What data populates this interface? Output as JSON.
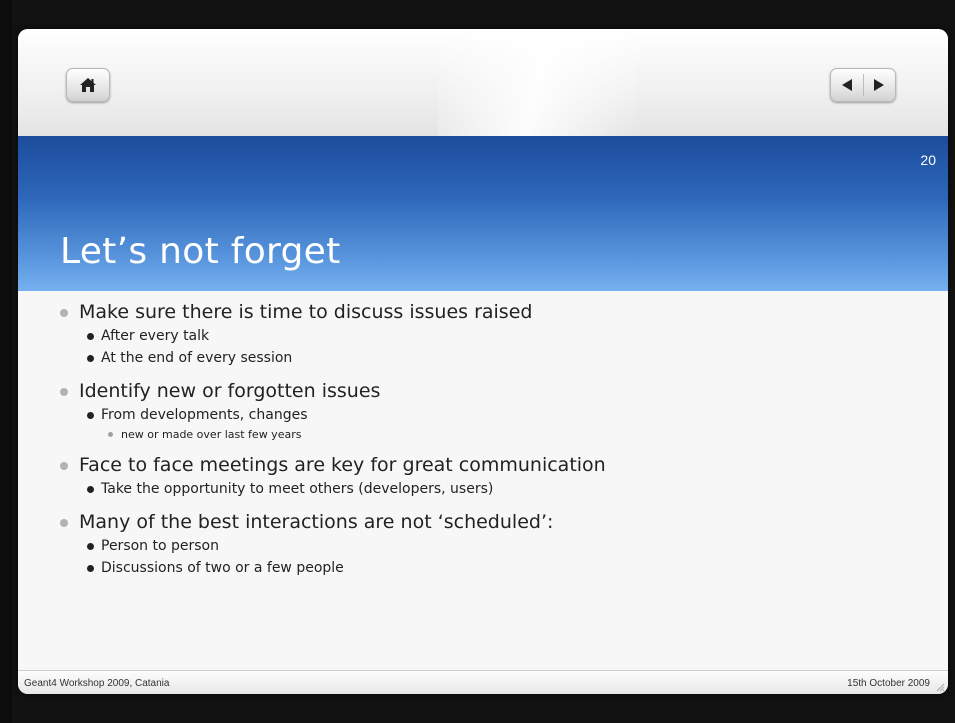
{
  "slide": {
    "number": "20",
    "title": "Let’s not forget",
    "bullets": [
      {
        "text": "Make sure there is time to discuss issues raised",
        "children": [
          {
            "text": "After every talk"
          },
          {
            "text": "At the end of every session"
          }
        ]
      },
      {
        "text": "Identify new or forgotten issues",
        "children": [
          {
            "text": "From developments, changes",
            "children": [
              {
                "text": "new or made over last few years"
              }
            ]
          }
        ]
      },
      {
        "text": "Face to face meetings are key for great communication",
        "children": [
          {
            "text": "Take the opportunity to meet others (developers, users)"
          }
        ]
      },
      {
        "text": "Many of the best interactions are not ‘scheduled’:",
        "children": [
          {
            "text": "Person to person"
          },
          {
            "text": "Discussions of two or a few people"
          }
        ]
      }
    ]
  },
  "footer": {
    "left": "Geant4 Workshop 2009, Catania",
    "right": "15th October 2009"
  },
  "nav": {
    "home_icon": "home-icon",
    "prev_icon": "previous-arrow-icon",
    "next_icon": "next-arrow-icon"
  },
  "colors": {
    "banner_top": "#1c4c9c",
    "banner_bottom": "#76b0f0",
    "title_text": "#ffffff"
  }
}
